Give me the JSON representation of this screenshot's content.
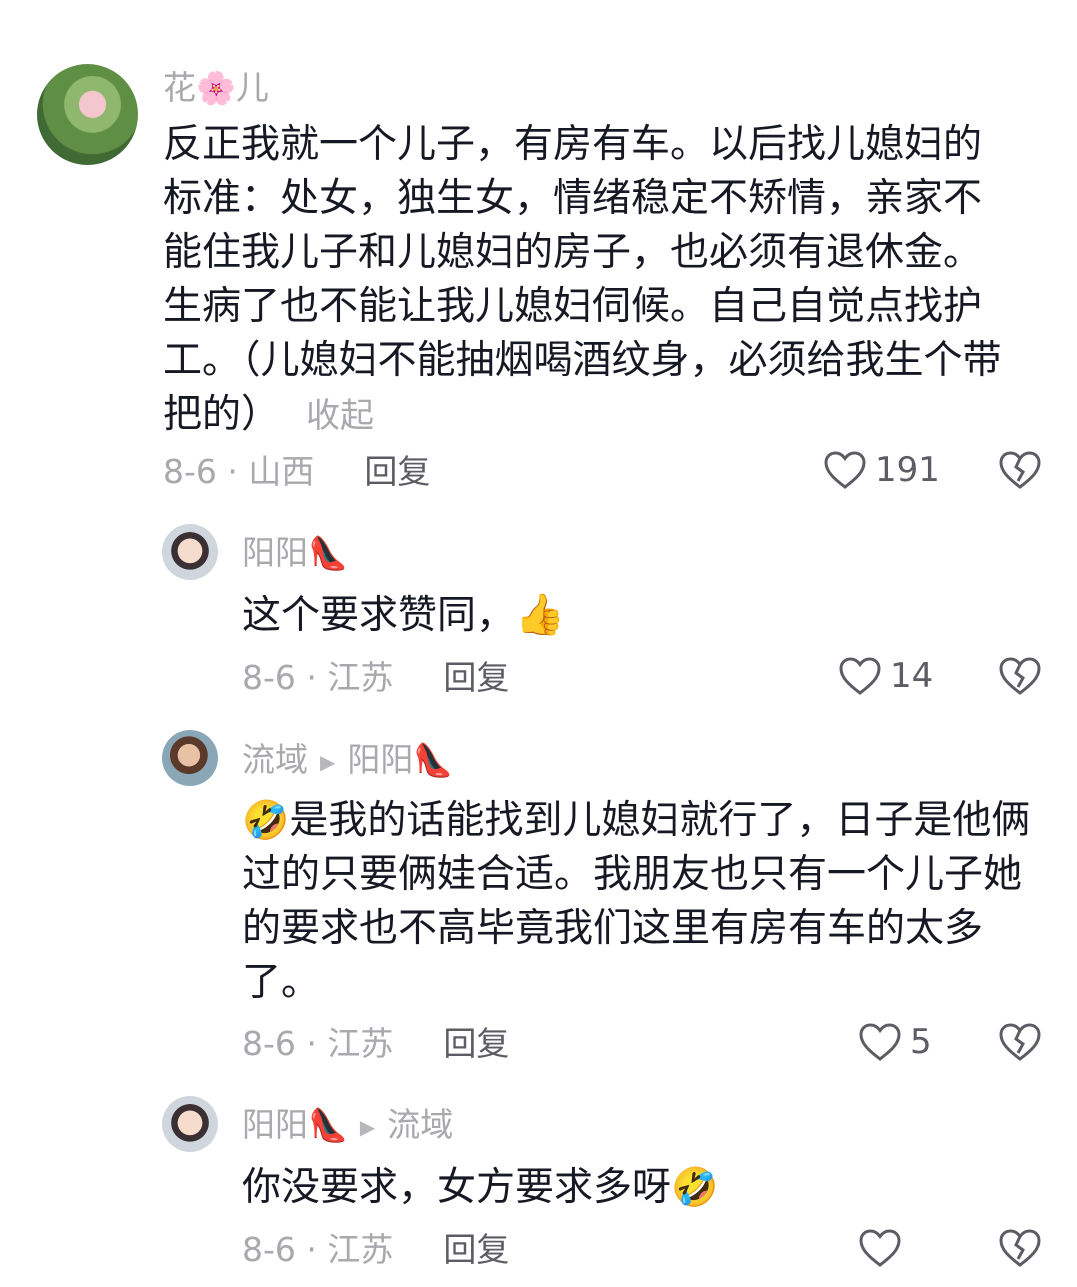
{
  "comments": [
    {
      "user": "花",
      "user_suffix": "儿",
      "user_emoji": "🌸",
      "text": "反正我就一个儿子，有房有车。以后找儿媳妇的标准：处女，独生女，情绪稳定不矫情，亲家不能住我儿子和儿媳妇的房子，也必须有退休金。生病了也不能让我儿媳妇伺候。自己自觉点找护工。（儿媳妇不能抽烟喝酒纹身，必须给我生个带把的）",
      "collapse_label": "收起",
      "date_location": "8-6 · 山西",
      "reply_label": "回复",
      "likes": "191"
    }
  ],
  "replies": [
    {
      "user": "阳阳",
      "user_emoji": "👠",
      "text": "这个要求赞同，",
      "text_emoji": "👍",
      "date_location": "8-6 · 江苏",
      "reply_label": "回复",
      "likes": "14"
    },
    {
      "user": "流域",
      "reply_to": "阳阳",
      "reply_to_emoji": "👠",
      "text_emoji": "🤣",
      "text": "是我的话能找到儿媳妇就行了，日子是他俩过的只要俩娃合适。我朋友也只有一个儿子她的要求也不高毕竟我们这里有房有车的太多了。",
      "date_location": "8-6 · 江苏",
      "reply_label": "回复",
      "likes": "5"
    },
    {
      "user": "阳阳",
      "user_emoji": "👠",
      "reply_to": "流域",
      "text": "你没要求，女方要求多呀",
      "text_emoji": "🤣",
      "date_location": "8-6 · 江苏",
      "reply_label": "回复",
      "likes": ""
    }
  ],
  "icons": {
    "like": "heart-outline-icon",
    "dislike": "broken-heart-icon",
    "reply_arrow": "triangle-right-icon"
  },
  "colors": {
    "text": "#161823",
    "meta": "#a8a8ad",
    "reply": "#5c5c64"
  }
}
